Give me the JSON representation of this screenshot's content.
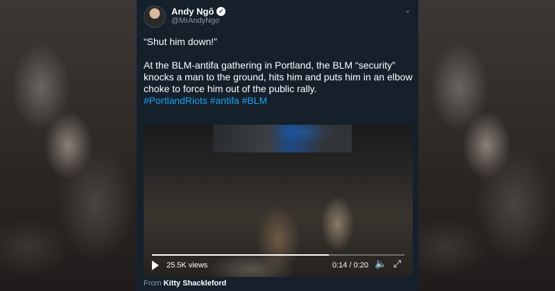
{
  "tweet": {
    "author_name": "Andy Ngô",
    "handle": "@MrAndyNgo",
    "quote": "“Shut him down!”",
    "body": "At the BLM-antifa gathering in Portland, the BLM “security” knocks a man to the ground, hits him and puts him in an elbow choke to force him out of the public rally.",
    "hashtags": "#PortlandRiots #antifa #BLM",
    "verified_glyph": "✓",
    "menu_glyph": "⌄"
  },
  "video": {
    "views": "25.5K views",
    "time": "0:14 / 0:20",
    "progress": 0.7,
    "play_icon": "play-icon",
    "volume_glyph": "🔈",
    "fullscreen_glyph": "⤢"
  },
  "source": {
    "prefix": "From",
    "name": "Kitty Shackleford"
  },
  "colors": {
    "card_bg": "#15202b",
    "link": "#1da1f2",
    "muted": "#8899a6"
  }
}
